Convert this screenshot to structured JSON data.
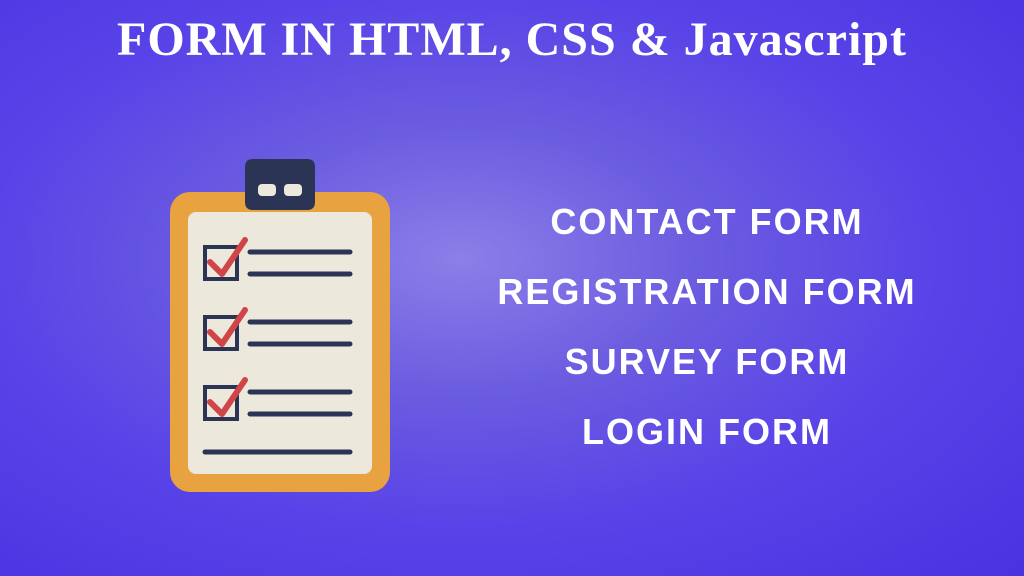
{
  "title": "FORM IN HTML, CSS & Javascript",
  "list": {
    "item1": "Contact Form",
    "item2": "Registration Form",
    "item3": "Survey Form",
    "item4": "Login Form"
  }
}
